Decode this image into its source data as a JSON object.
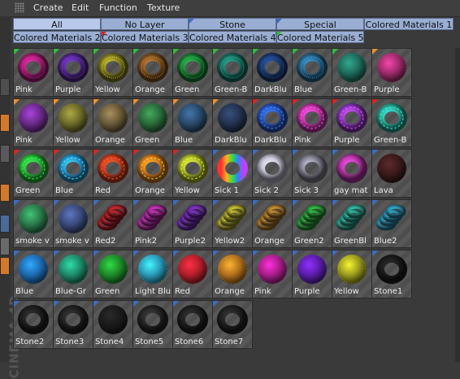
{
  "menu": [
    "Create",
    "Edit",
    "Function",
    "Texture"
  ],
  "tabs_row1": [
    {
      "label": "All",
      "flag": "none",
      "active": true
    },
    {
      "label": "No Layer",
      "flag": "none"
    },
    {
      "label": "Stone",
      "flag": "blue"
    },
    {
      "label": "Special",
      "flag": "blue"
    },
    {
      "label": "Colored Materials 1",
      "flag": "none"
    }
  ],
  "tabs_row2": [
    {
      "label": "Colored Materials 2",
      "flag": "none"
    },
    {
      "label": "Colored Materials 3",
      "flag": "red"
    },
    {
      "label": "Colored Materials 4",
      "flag": "none"
    },
    {
      "label": "Colored Materials 5",
      "flag": "green"
    }
  ],
  "brand": "CINEMA 4D",
  "materials": [
    {
      "label": "Pink",
      "color": "#b8207e",
      "shape": "torus-fuzzy",
      "flag": "#2fbf3a"
    },
    {
      "label": "Purple",
      "color": "#5a2b9a",
      "shape": "torus-fuzzy",
      "flag": "#2fbf3a"
    },
    {
      "label": "Yellow",
      "color": "#8f8a22",
      "shape": "torus-fuzzy",
      "flag": "#2fbf3a"
    },
    {
      "label": "Orange",
      "color": "#8b5a24",
      "shape": "torus-fuzzy",
      "flag": "#2fbf3a"
    },
    {
      "label": "Green",
      "color": "#1e8a3a",
      "shape": "torus-fuzzy",
      "flag": "#2fbf3a"
    },
    {
      "label": "Green-B",
      "color": "#1d7a6a",
      "shape": "torus-fuzzy",
      "flag": "#2fbf3a"
    },
    {
      "label": "DarkBlu",
      "color": "#1e3f7a",
      "shape": "torus-fuzzy",
      "flag": "#2fbf3a"
    },
    {
      "label": "Blue",
      "color": "#2a6f9a",
      "shape": "torus-fuzzy",
      "flag": "#2fbf3a"
    },
    {
      "label": "Green-B",
      "color": "#1e6a5a",
      "shape": "sphere-fuzzy",
      "flag": "#2fbf3a"
    },
    {
      "label": "Purple",
      "color": "#9b2c6a",
      "shape": "sphere-fuzzy",
      "flag": "#f0902a"
    },
    {
      "label": "Pink",
      "color": "#6a2a8a",
      "shape": "sphere-fuzzy",
      "flag": "#f0902a"
    },
    {
      "label": "Yellow",
      "color": "#6d6a2a",
      "shape": "sphere-fuzzy",
      "flag": "#f0902a"
    },
    {
      "label": "Orange",
      "color": "#6a5a3a",
      "shape": "sphere-fuzzy",
      "flag": "#f0902a"
    },
    {
      "label": "Green",
      "color": "#2a6a3a",
      "shape": "sphere-fuzzy",
      "flag": "#f0902a"
    },
    {
      "label": "Blue",
      "color": "#2a4a6a",
      "shape": "sphere-fuzzy",
      "flag": "#f0902a"
    },
    {
      "label": "DarkBlu",
      "color": "#23324f",
      "shape": "sphere-fuzzy",
      "flag": "#f0902a"
    },
    {
      "label": "DarkBlu",
      "color": "#2a5ad0",
      "shape": "torus-pattern",
      "flag": "#e02020"
    },
    {
      "label": "Pink",
      "color": "#d93ab8",
      "shape": "torus-pattern",
      "flag": "#e02020"
    },
    {
      "label": "Purple",
      "color": "#9a3ad0",
      "shape": "torus-pattern",
      "flag": "#e02020"
    },
    {
      "label": "Green-B",
      "color": "#2ab8a0",
      "shape": "torus-pattern",
      "flag": "#e02020"
    },
    {
      "label": "Green",
      "color": "#2ac83a",
      "shape": "torus-pattern",
      "flag": "#e02020"
    },
    {
      "label": "Blue",
      "color": "#2a9ad8",
      "shape": "torus-pattern",
      "flag": "#e02020"
    },
    {
      "label": "Red",
      "color": "#d8401e",
      "shape": "torus-pattern",
      "flag": "#e02020"
    },
    {
      "label": "Orange",
      "color": "#e0801e",
      "shape": "torus-pattern",
      "flag": "#e02020"
    },
    {
      "label": "Yellow",
      "color": "#b8c82a",
      "shape": "torus-pattern",
      "flag": "#e02020"
    },
    {
      "label": "Sick 1",
      "color": "#d84a8a",
      "shape": "torus-rainbow",
      "flag": "#3a6ec9"
    },
    {
      "label": "Sick 2",
      "color": "#c8c8d8",
      "shape": "torus-plain",
      "flag": "#3a6ec9"
    },
    {
      "label": "Sick 3",
      "color": "#8a8a9a",
      "shape": "torus-plain",
      "flag": "#3a6ec9"
    },
    {
      "label": "gay mat",
      "color": "#c83ab8",
      "shape": "torus-plain",
      "flag": "#3a6ec9"
    },
    {
      "label": "Lava",
      "color": "#3a1a1a",
      "shape": "sphere-fuzzy",
      "flag": "#3a6ec9"
    },
    {
      "label": "smoke v",
      "color": "#2a7a4a",
      "shape": "sphere-fuzzy",
      "flag": "#3a6ec9"
    },
    {
      "label": "smoke v",
      "color": "#3a4a7a",
      "shape": "sphere-fuzzy",
      "flag": "#3a6ec9"
    },
    {
      "label": "Red2",
      "color": "#a82028",
      "shape": "coil",
      "flag": "#3a6ec9"
    },
    {
      "label": "Pink2",
      "color": "#a82a9a",
      "shape": "coil",
      "flag": "#3a6ec9"
    },
    {
      "label": "Purple2",
      "color": "#6a2aa8",
      "shape": "coil",
      "flag": "#3a6ec9"
    },
    {
      "label": "Yellow2",
      "color": "#a8a02a",
      "shape": "coil",
      "flag": "#3a6ec9"
    },
    {
      "label": "Orange",
      "color": "#a8782a",
      "shape": "coil",
      "flag": "#3a6ec9"
    },
    {
      "label": "Green2",
      "color": "#2a9a3a",
      "shape": "coil",
      "flag": "#3a6ec9"
    },
    {
      "label": "GreenBl",
      "color": "#2a9a8a",
      "shape": "coil",
      "flag": "#3a6ec9"
    },
    {
      "label": "Blue2",
      "color": "#2a8aa8",
      "shape": "coil",
      "flag": "#3a6ec9"
    },
    {
      "label": "Blue",
      "color": "#1e6ab0",
      "shape": "sphere-fuzzy",
      "flag": "#3a6ec9"
    },
    {
      "label": "Blue-Gr",
      "color": "#1e8a6a",
      "shape": "sphere-fuzzy",
      "flag": "#3a6ec9"
    },
    {
      "label": "Green",
      "color": "#1e8a2a",
      "shape": "sphere-fuzzy",
      "flag": "#3a6ec9"
    },
    {
      "label": "Light Blu",
      "color": "#2a9ab8",
      "shape": "sphere-fuzzy",
      "flag": "#3a6ec9"
    },
    {
      "label": "Red",
      "color": "#b01e2a",
      "shape": "sphere-fuzzy",
      "flag": "#3a6ec9"
    },
    {
      "label": "Orange",
      "color": "#b0701e",
      "shape": "sphere-fuzzy",
      "flag": "#3a6ec9"
    },
    {
      "label": "Pink",
      "color": "#a81e8a",
      "shape": "sphere-fuzzy",
      "flag": "#3a6ec9"
    },
    {
      "label": "Purple",
      "color": "#5a1ea8",
      "shape": "sphere-fuzzy",
      "flag": "#3a6ec9"
    },
    {
      "label": "Yellow",
      "color": "#9a9a1e",
      "shape": "sphere-fuzzy",
      "flag": "#3a6ec9"
    },
    {
      "label": "Stone1",
      "color": "#1e1e1e",
      "shape": "torus-plain",
      "flag": "#3a6ec9"
    },
    {
      "label": "Stone2",
      "color": "#222222",
      "shape": "torus-plain",
      "flag": "#3a6ec9"
    },
    {
      "label": "Stone3",
      "color": "#262626",
      "shape": "torus-plain",
      "flag": "#3a6ec9"
    },
    {
      "label": "Stone4",
      "color": "#1a1a1a",
      "shape": "sphere-fuzzy",
      "flag": "#3a6ec9"
    },
    {
      "label": "Stone5",
      "color": "#2a2a2a",
      "shape": "torus-plain",
      "flag": "#3a6ec9"
    },
    {
      "label": "Stone6",
      "color": "#232323",
      "shape": "torus-plain",
      "flag": "#3a6ec9"
    },
    {
      "label": "Stone7",
      "color": "#252525",
      "shape": "torus-plain",
      "flag": "#3a6ec9"
    }
  ]
}
